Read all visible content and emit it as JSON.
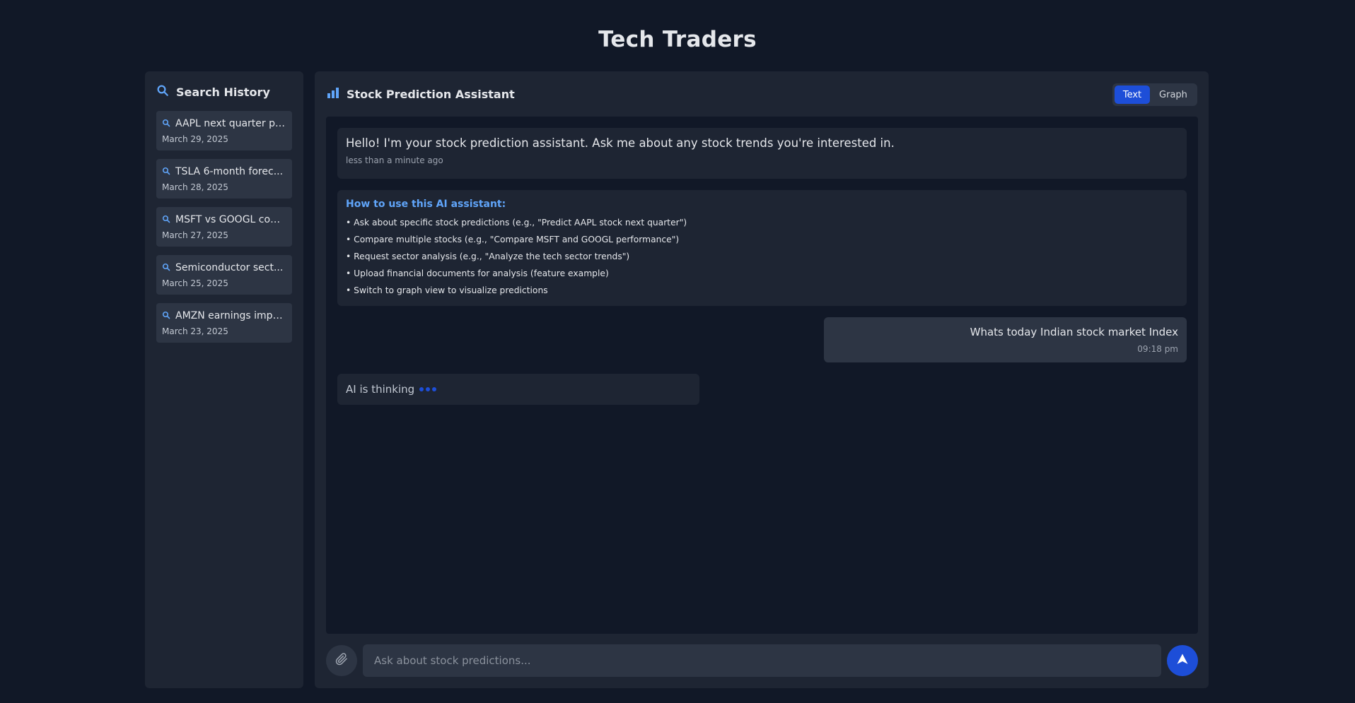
{
  "app": {
    "title": "Tech Traders"
  },
  "sidebar": {
    "title": "Search History",
    "items": [
      {
        "query": "AAPL next quarter pre...",
        "date": "March 29, 2025"
      },
      {
        "query": "TSLA 6-month forec...",
        "date": "March 28, 2025"
      },
      {
        "query": "MSFT vs GOOGL com...",
        "date": "March 27, 2025"
      },
      {
        "query": "Semiconductor sect...",
        "date": "March 25, 2025"
      },
      {
        "query": "AMZN earnings impa...",
        "date": "March 23, 2025"
      }
    ]
  },
  "main": {
    "title": "Stock Prediction Assistant",
    "toggle": {
      "text_label": "Text",
      "graph_label": "Graph",
      "active": "Text"
    },
    "messages": {
      "greeting": {
        "text": "Hello! I'm your stock prediction assistant. Ask me about any stock trends you're interested in.",
        "time": "less than a minute ago"
      },
      "howto": {
        "title": "How to use this AI assistant:",
        "tips": [
          "• Ask about specific stock predictions (e.g., \"Predict AAPL stock next quarter\")",
          "• Compare multiple stocks (e.g., \"Compare MSFT and GOOGL performance\")",
          "• Request sector analysis (e.g., \"Analyze the tech sector trends\")",
          "• Upload financial documents for analysis (feature example)",
          "• Switch to graph view to visualize predictions"
        ]
      },
      "user": {
        "text": "Whats today Indian stock market Index",
        "time": "09:18 pm"
      },
      "thinking": {
        "text": "AI is thinking"
      }
    },
    "input": {
      "placeholder": "Ask about stock predictions..."
    }
  },
  "icons": {
    "search": "search-icon",
    "chart": "bar-chart-icon",
    "attach": "paperclip-icon",
    "send": "send-arrow-icon"
  },
  "colors": {
    "accent": "#1d4ed8",
    "accent_light": "#60a5fa",
    "background": "#111827",
    "panel": "#1e2533"
  }
}
